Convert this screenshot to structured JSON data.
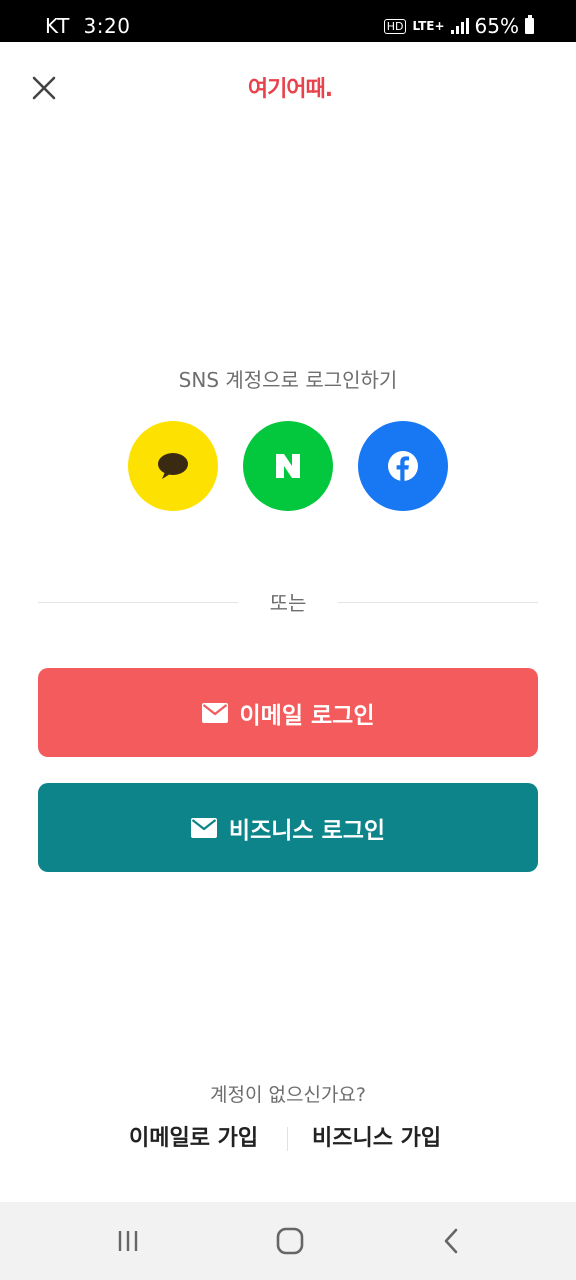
{
  "status_bar": {
    "carrier": "KT",
    "time": "3:20",
    "hd": "HD",
    "network": "LTE+",
    "battery": "65%"
  },
  "header": {
    "close_icon": "close-icon",
    "logo_text": "여기어때."
  },
  "sns": {
    "title": "SNS 계정으로 로그인하기",
    "providers": [
      {
        "name": "kakao",
        "icon": "speech-bubble-icon",
        "color": "#fde100"
      },
      {
        "name": "naver",
        "icon": "naver-n-icon",
        "color": "#03c73c"
      },
      {
        "name": "facebook",
        "icon": "facebook-f-icon",
        "color": "#1877f2"
      }
    ]
  },
  "divider": {
    "text": "또는"
  },
  "buttons": {
    "email_login": "이메일 로그인",
    "business_login": "비즈니스 로그인",
    "email_color": "#f35b5c",
    "business_color": "#0c848a",
    "icon": "envelope-icon"
  },
  "signup": {
    "prompt": "계정이 없으신가요?",
    "email_signup": "이메일로 가입",
    "business_signup": "비즈니스 가입"
  },
  "nav_bar": {
    "recent_icon": "recent-apps-icon",
    "home_icon": "home-icon",
    "back_icon": "back-icon"
  }
}
